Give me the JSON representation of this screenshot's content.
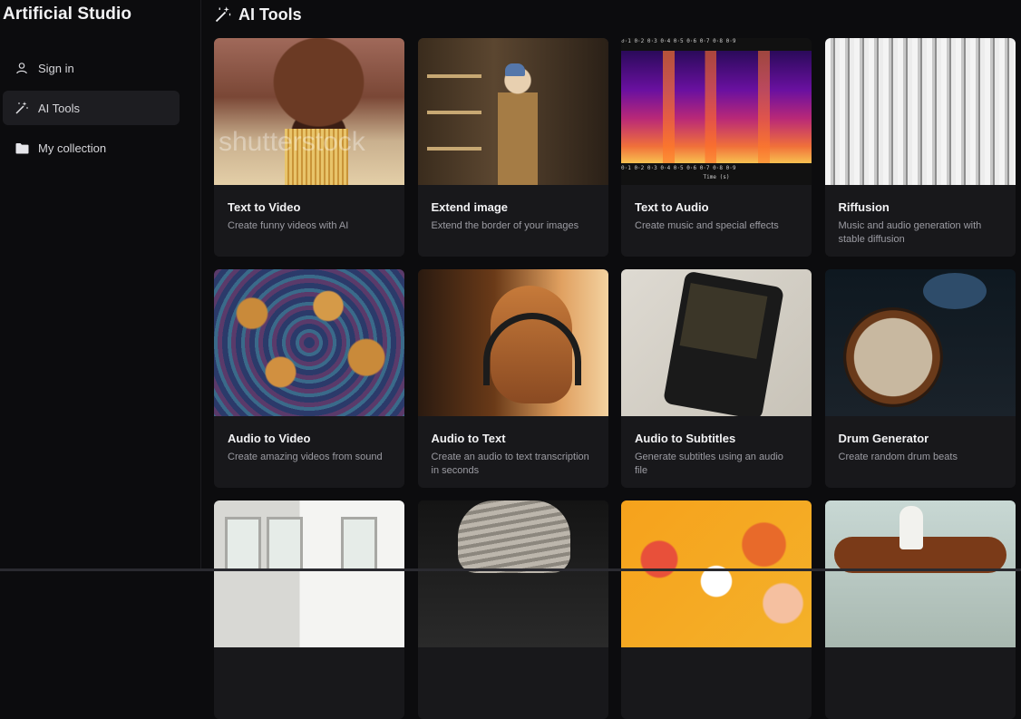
{
  "app": {
    "title": "Artificial Studio"
  },
  "sidebar": {
    "items": [
      {
        "label": "Sign in",
        "icon": "user-icon",
        "active": false
      },
      {
        "label": "AI Tools",
        "icon": "magic-wand-icon",
        "active": true
      },
      {
        "label": "My collection",
        "icon": "folder-icon",
        "active": false
      }
    ]
  },
  "page": {
    "title": "AI Tools",
    "icon": "magic-wand-icon"
  },
  "tools": [
    {
      "title": "Text to Video",
      "description": "Create funny videos with AI",
      "thumb_watermark": "shutterstock"
    },
    {
      "title": "Extend image",
      "description": "Extend the border of your images"
    },
    {
      "title": "Text to Audio",
      "description": "Create music and special effects",
      "thumb_ticks": "0·1  0·2  0·3  0·4  0·5  0·6  0·7  0·8  0·9",
      "thumb_axis": "Time (s)"
    },
    {
      "title": "Riffusion",
      "description": "Music and audio generation with stable diffusion"
    },
    {
      "title": "Audio to Video",
      "description": "Create amazing videos from sound"
    },
    {
      "title": "Audio to Text",
      "description": "Create an audio to text transcription in seconds"
    },
    {
      "title": "Audio to Subtitles",
      "description": "Generate subtitles using an audio file"
    },
    {
      "title": "Drum Generator",
      "description": "Create random drum beats"
    },
    {
      "title": "",
      "description": ""
    },
    {
      "title": "",
      "description": ""
    },
    {
      "title": "",
      "description": ""
    },
    {
      "title": "",
      "description": ""
    }
  ],
  "colors": {
    "background": "#0c0c0e",
    "card": "#18181b",
    "active_nav": "#1d1d21",
    "muted_text": "#9c9ca3"
  }
}
